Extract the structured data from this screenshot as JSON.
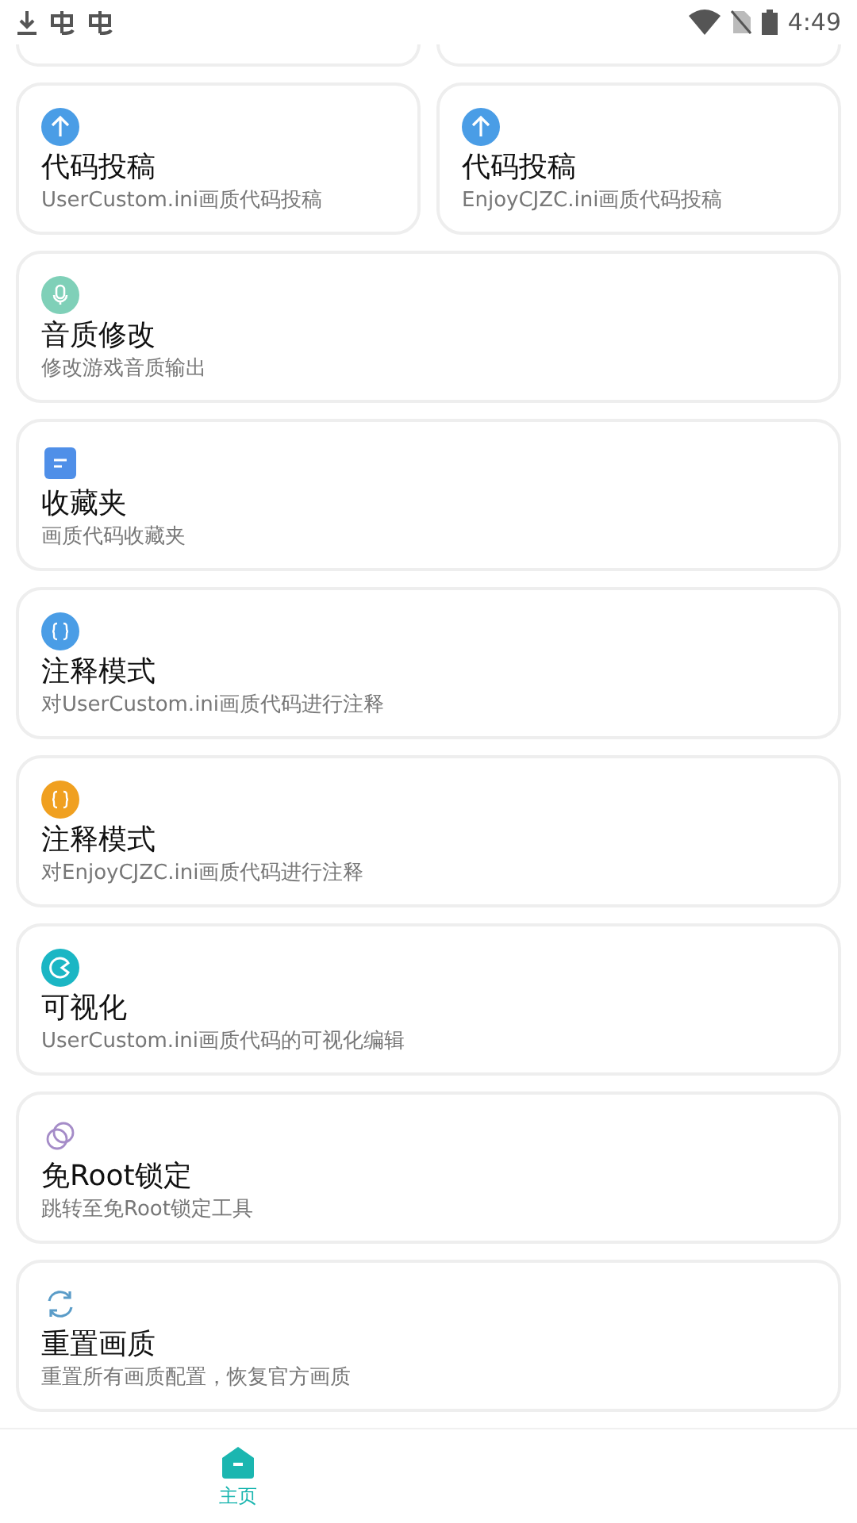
{
  "status_bar": {
    "time": "4:49"
  },
  "rows": [
    [
      {
        "kind": "upload",
        "color": "#4a9de6",
        "title": "代码投稿",
        "subtitle": "UserCustom.ini画质代码投稿"
      },
      {
        "kind": "upload",
        "color": "#4a9de6",
        "title": "代码投稿",
        "subtitle": "EnjoyCJZC.ini画质代码投稿"
      }
    ],
    [
      {
        "kind": "mic",
        "color": "#7fd0b8",
        "title": "音质修改",
        "subtitle": "修改游戏音质输出"
      }
    ],
    [
      {
        "kind": "note",
        "color": "#4f8fe8",
        "title": "收藏夹",
        "subtitle": "画质代码收藏夹"
      }
    ],
    [
      {
        "kind": "braces",
        "color": "#4a9de6",
        "title": "注释模式",
        "subtitle": "对UserCustom.ini画质代码进行注释"
      }
    ],
    [
      {
        "kind": "braces",
        "color": "#f0a020",
        "title": "注释模式",
        "subtitle": "对EnjoyCJZC.ini画质代码进行注释"
      }
    ],
    [
      {
        "kind": "palette",
        "color": "#1bb6c4",
        "title": "可视化",
        "subtitle": "UserCustom.ini画质代码的可视化编辑"
      }
    ],
    [
      {
        "kind": "rings",
        "color": "#a58cc8",
        "title": "免Root锁定",
        "subtitle": "跳转至免Root锁定工具"
      }
    ],
    [
      {
        "kind": "refresh",
        "color": "#5a9cc8",
        "title": "重置画质",
        "subtitle": "重置所有画质配置，恢复官方画质"
      }
    ]
  ],
  "bottom_nav": [
    {
      "label": "主页",
      "selected": true
    }
  ]
}
